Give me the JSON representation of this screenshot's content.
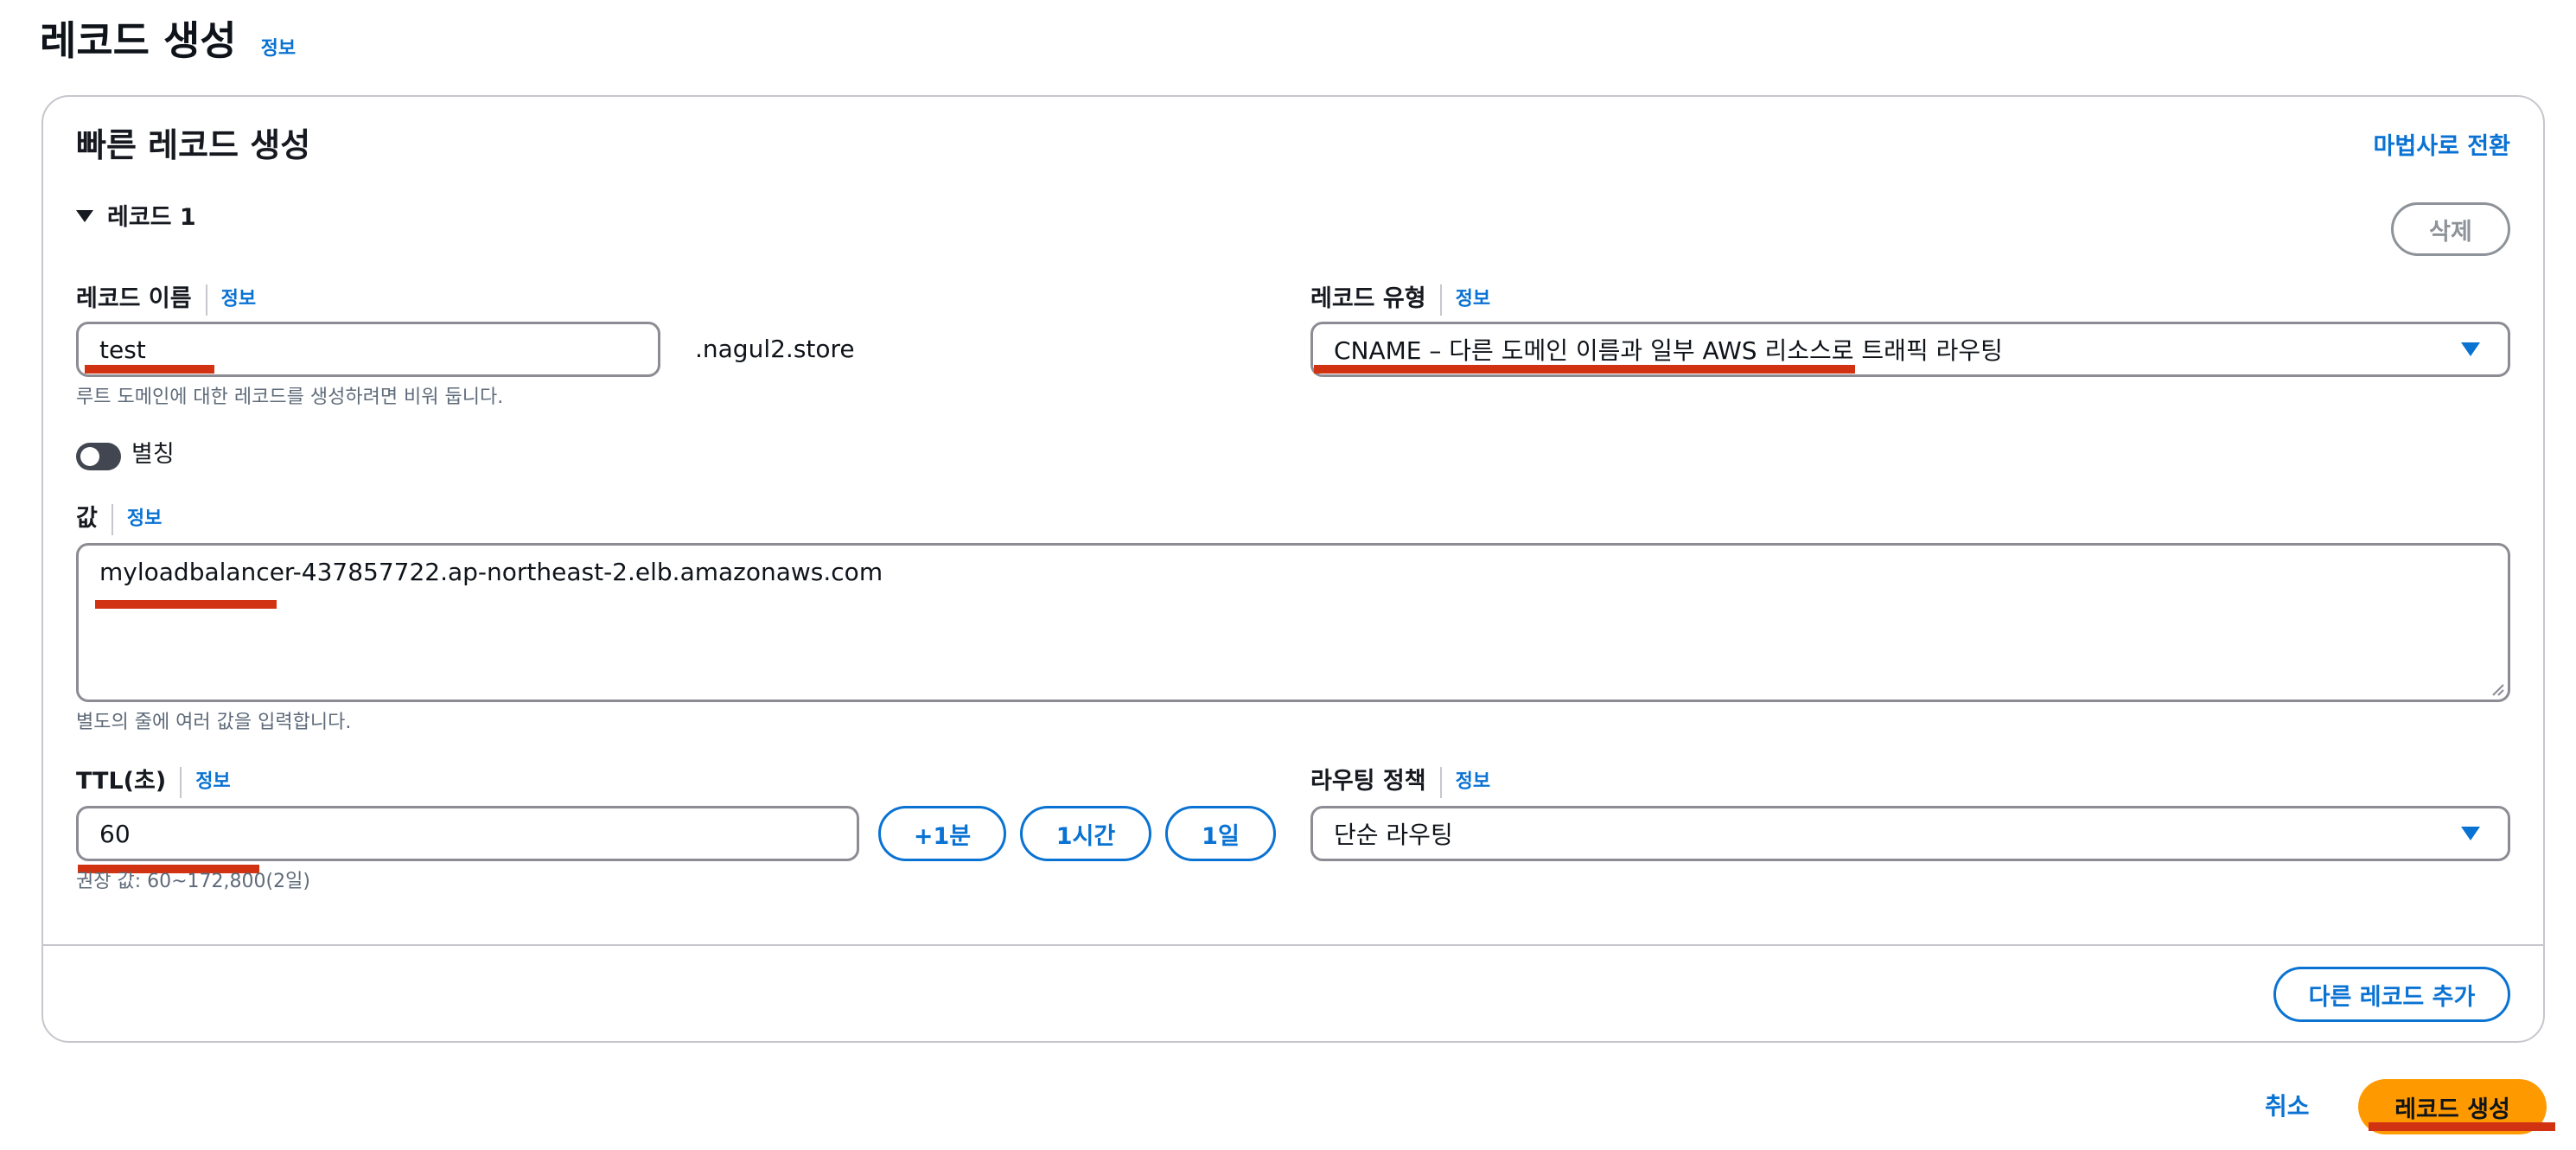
{
  "page": {
    "title": "레코드 생성",
    "title_info": "정보"
  },
  "panel": {
    "title": "빠른 레코드 생성",
    "switch_wizard": "마법사로 전환",
    "record_header": "레코드 1",
    "delete_button": "삭제",
    "add_record_button": "다른 레코드 추가"
  },
  "record_name": {
    "label": "레코드 이름",
    "info": "정보",
    "value": "test",
    "suffix": ".nagul2.store",
    "hint": "루트 도메인에 대한 레코드를 생성하려면 비워 둡니다."
  },
  "record_type": {
    "label": "레코드 유형",
    "info": "정보",
    "selected": "CNAME – 다른 도메인 이름과 일부 AWS 리소스로 트래픽 라우팅"
  },
  "alias": {
    "label": "별칭",
    "enabled": false
  },
  "value": {
    "label": "값",
    "info": "정보",
    "text": "myloadbalancer-437857722.ap-northeast-2.elb.amazonaws.com",
    "hint": "별도의 줄에 여러 값을 입력합니다."
  },
  "ttl": {
    "label": "TTL(초)",
    "info": "정보",
    "value": "60",
    "hint": "권장 값: 60~172,800(2일)",
    "quick_buttons": [
      "+1분",
      "1시간",
      "1일"
    ]
  },
  "routing_policy": {
    "label": "라우팅 정책",
    "info": "정보",
    "selected": "단순 라우팅"
  },
  "footer": {
    "cancel": "취소",
    "create": "레코드 생성"
  },
  "colors": {
    "accent": "#0972d3",
    "primary_button": "#ff9900",
    "annotation": "#d13212"
  }
}
